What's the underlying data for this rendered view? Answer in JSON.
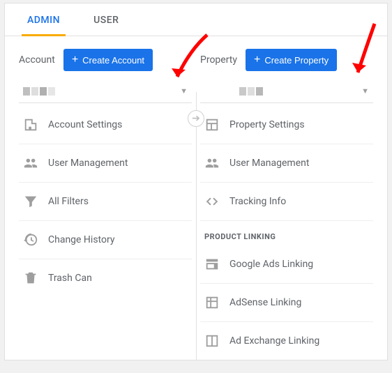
{
  "tabs": {
    "admin": "ADMIN",
    "user": "USER"
  },
  "account": {
    "label": "Account",
    "create_label": "Create Account",
    "items": [
      {
        "label": "Account Settings"
      },
      {
        "label": "User Management"
      },
      {
        "label": "All Filters"
      },
      {
        "label": "Change History"
      },
      {
        "label": "Trash Can"
      }
    ]
  },
  "property": {
    "label": "Property",
    "create_label": "Create Property",
    "items": [
      {
        "label": "Property Settings"
      },
      {
        "label": "User Management"
      },
      {
        "label": "Tracking Info"
      }
    ],
    "product_linking_label": "PRODUCT LINKING",
    "product_linking": [
      {
        "label": "Google Ads Linking"
      },
      {
        "label": "AdSense Linking"
      },
      {
        "label": "Ad Exchange Linking"
      }
    ]
  }
}
